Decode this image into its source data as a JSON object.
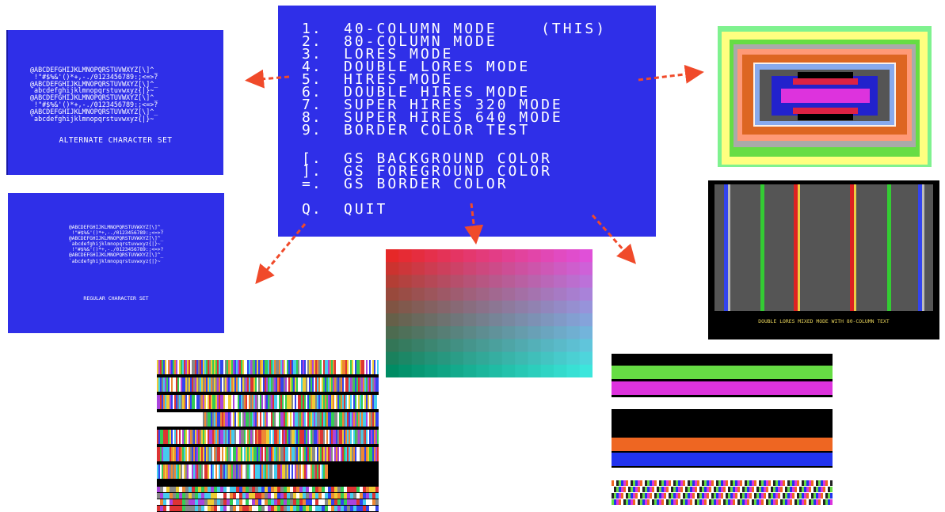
{
  "menu": {
    "items": [
      {
        "key": "1.",
        "label": "40-COLUMN MODE    (THIS)"
      },
      {
        "key": "2.",
        "label": "80-COLUMN MODE"
      },
      {
        "key": "3.",
        "label": "LORES MODE"
      },
      {
        "key": "4.",
        "label": "DOUBLE LORES MODE"
      },
      {
        "key": "5.",
        "label": "HIRES MODE"
      },
      {
        "key": "6.",
        "label": "DOUBLE HIRES MODE"
      },
      {
        "key": "7.",
        "label": "SUPER HIRES 320 MODE"
      },
      {
        "key": "8.",
        "label": "SUPER HIRES 640 MODE"
      },
      {
        "key": "9.",
        "label": "BORDER COLOR TEST"
      },
      {
        "key": "[.",
        "label": "GS BACKGROUND COLOR"
      },
      {
        "key": "].",
        "label": "GS FOREGROUND COLOR"
      },
      {
        "key": "=.",
        "label": "GS BORDER COLOR"
      },
      {
        "key": "Q.",
        "label": "QUIT"
      }
    ]
  },
  "alt_charset": {
    "lines": [
      "@ABCDEFGHIJKLMNOPQRSTUVWXYZ[\\]^_",
      " !\"#$%&'()*+,-./0123456789:;<=>?",
      "@ABCDEFGHIJKLMNOPQRSTUVWXYZ[\\]^_",
      "`abcdefghijklmnopqrstuvwxyz{|}~",
      "@ABCDEFGHIJKLMNOPQRSTUVWXYZ[\\]^_",
      " !\"#$%&'()*+,-./0123456789:;<=>?",
      "@ABCDEFGHIJKLMNOPQRSTUVWXYZ[\\]^_",
      "`abcdefghijklmnopqrstuvwxyz{|}~"
    ],
    "caption": "ALTERNATE CHARACTER SET"
  },
  "reg_charset": {
    "lines": [
      "@ABCDEFGHIJKLMNOPQRSTUVWXYZ[\\]^_",
      " !\"#$%&'()*+,-./0123456789:;<=>?",
      "@ABCDEFGHIJKLMNOPQRSTUVWXYZ[\\]^_",
      "`abcdefghijklmnopqrstuvwxyz{|}~",
      " !\"#$%&'()*+,-./0123456789:;<=>?",
      "@ABCDEFGHIJKLMNOPQRSTUVWXYZ[\\]^_",
      "`abcdefghijklmnopqrstuvwxyz{|}~"
    ],
    "caption": "REGULAR CHARACTER SET"
  },
  "double_lores": {
    "caption": "DOUBLE LORES MIXED MODE WITH 80-COLUMN TEXT"
  },
  "colors": {
    "screen_blue": "#2f2fe8",
    "arrow": "#f04a2a"
  }
}
